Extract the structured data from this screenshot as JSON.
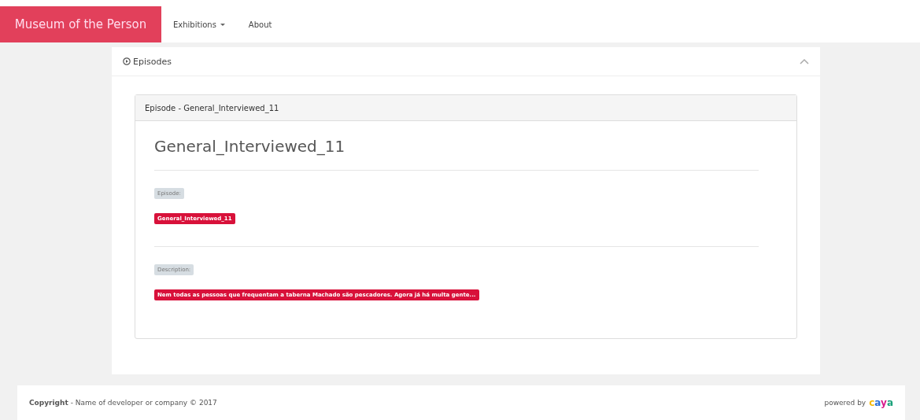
{
  "navbar": {
    "brand": "Museum of the Person",
    "items": [
      {
        "label": "Exhibitions",
        "dropdown": true
      },
      {
        "label": "About",
        "dropdown": false
      }
    ]
  },
  "panel": {
    "title": "Episodes",
    "expanded": true,
    "card": {
      "header": "Episode - General_Interviewed_11",
      "title": "General_Interviewed_11",
      "fields": [
        {
          "label": "Episode:",
          "value": "General_Interviewed_11"
        },
        {
          "label": "Description:",
          "value": "Nem todas as pessoas que frequentam a taberna Machado são pescadores. Agora já há multa gente..."
        }
      ]
    }
  },
  "footer": {
    "copyright": "**Copyright** - Name of developer or company © 2017",
    "powered_by": "powered by",
    "logo": "caya"
  }
}
